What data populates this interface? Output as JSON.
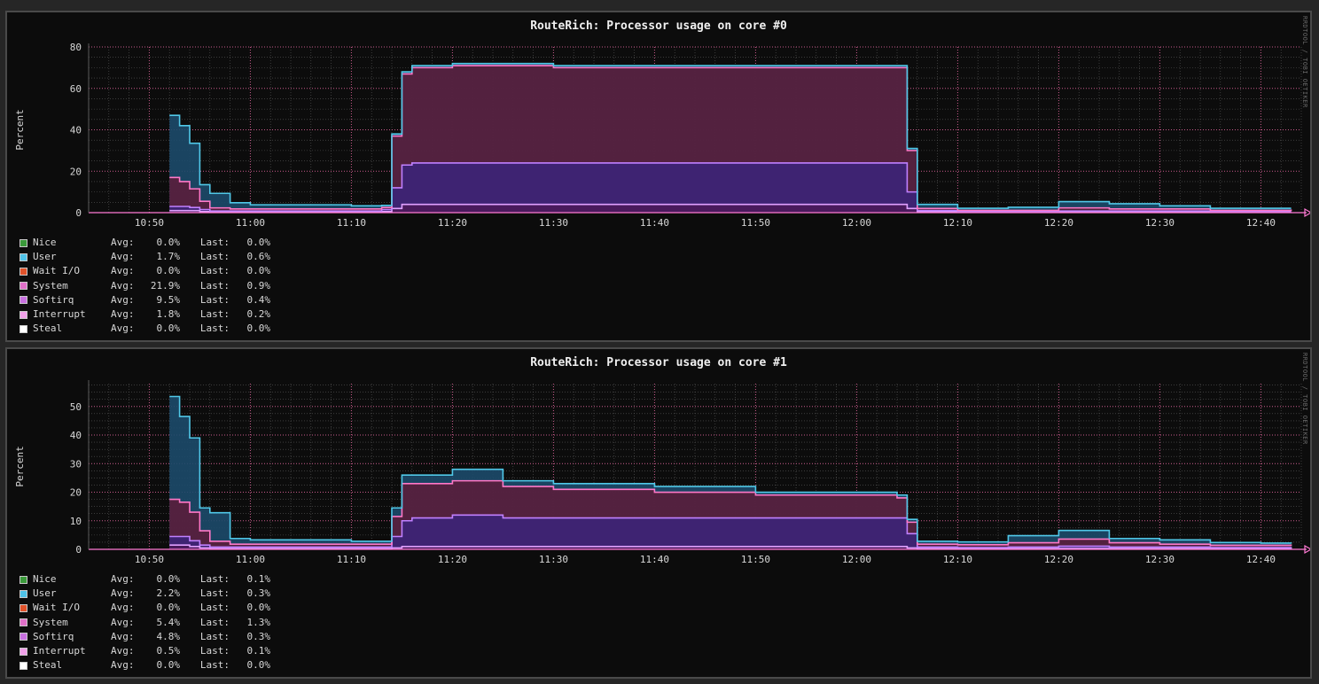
{
  "chart_data": [
    {
      "type": "area",
      "title": "RouteRich: Processor usage on core #0",
      "ylabel": "Percent",
      "xlabel": "",
      "watermark": "RRDTOOL / TOBI OETIKER",
      "ylim": [
        0,
        80
      ],
      "yticks": [
        0,
        20,
        40,
        60,
        80
      ],
      "xlim": [
        "10:44",
        "12:44"
      ],
      "xticks": [
        "10:50",
        "11:00",
        "11:10",
        "11:20",
        "11:30",
        "11:40",
        "11:50",
        "12:00",
        "12:10",
        "12:20",
        "12:30",
        "12:40"
      ],
      "grid": true,
      "stacked": true,
      "legend_position": "bottom-left",
      "x": [
        "10:52",
        "10:53",
        "10:54",
        "10:55",
        "10:56",
        "10:58",
        "11:00",
        "11:05",
        "11:10",
        "11:13",
        "11:14",
        "11:15",
        "11:16",
        "11:20",
        "11:30",
        "11:40",
        "11:50",
        "12:00",
        "12:04",
        "12:05",
        "12:06",
        "12:10",
        "12:15",
        "12:20",
        "12:25",
        "12:30",
        "12:35",
        "12:40",
        "12:43"
      ],
      "series": [
        {
          "name": "Interrupt",
          "values": [
            1,
            1,
            1,
            0.5,
            0.3,
            0.3,
            0.3,
            0.3,
            0.3,
            0.5,
            2,
            4,
            4,
            4,
            4,
            4,
            4,
            4,
            4,
            2,
            0.5,
            0.3,
            0.3,
            0.3,
            0.3,
            0.3,
            0.3,
            0.3,
            0.3
          ]
        },
        {
          "name": "Softirq",
          "values": [
            2,
            2,
            1.5,
            1,
            0.5,
            0.5,
            0.5,
            0.5,
            0.5,
            1,
            10,
            19,
            20,
            20,
            20,
            20,
            20,
            20,
            20,
            8,
            0.5,
            0.3,
            0.3,
            0.5,
            0.5,
            0.5,
            0.3,
            0.3,
            0.3
          ]
        },
        {
          "name": "System",
          "values": [
            14,
            12,
            9,
            4,
            1.5,
            1,
            1,
            1,
            1,
            1,
            25,
            44,
            46,
            47,
            46,
            46,
            46,
            46,
            46,
            20,
            1,
            0.5,
            0.5,
            1.5,
            1,
            1,
            0.5,
            0.5,
            0.9
          ]
        },
        {
          "name": "Wait I/O",
          "values": [
            0,
            0,
            0,
            0,
            0,
            0,
            0,
            0,
            0,
            0,
            0,
            0,
            0,
            0,
            0,
            0,
            0,
            0,
            0,
            0,
            0,
            0,
            0,
            0,
            0,
            0,
            0,
            0,
            0
          ]
        },
        {
          "name": "User",
          "values": [
            30,
            27,
            22,
            8,
            7,
            3,
            2,
            2,
            1.5,
            1,
            1,
            1,
            1,
            1,
            1,
            1,
            1,
            1,
            1,
            1,
            2,
            1,
            1.5,
            3,
            2.5,
            1.5,
            1,
            1,
            0.6
          ]
        },
        {
          "name": "Nice",
          "values": [
            0,
            0,
            0,
            0,
            0,
            0,
            0,
            0,
            0,
            0,
            0,
            0,
            0,
            0,
            0,
            0,
            0,
            0,
            0,
            0,
            0,
            0,
            0,
            0,
            0,
            0,
            0,
            0,
            0
          ]
        },
        {
          "name": "Steal",
          "values": [
            0,
            0,
            0,
            0,
            0,
            0,
            0,
            0,
            0,
            0,
            0,
            0,
            0,
            0,
            0,
            0,
            0,
            0,
            0,
            0,
            0,
            0,
            0,
            0,
            0,
            0,
            0,
            0,
            0
          ]
        }
      ],
      "legend": [
        {
          "name": "Nice",
          "avg": "0.0%",
          "last": "0.0%",
          "color": "#3a9a3a"
        },
        {
          "name": "User",
          "avg": "1.7%",
          "last": "0.6%",
          "color": "#4fc3e8"
        },
        {
          "name": "Wait I/O",
          "avg": "0.0%",
          "last": "0.0%",
          "color": "#e0522a"
        },
        {
          "name": "System",
          "avg": "21.9%",
          "last": "0.9%",
          "color": "#e070c8"
        },
        {
          "name": "Softirq",
          "avg": "9.5%",
          "last": "0.4%",
          "color": "#c870e0"
        },
        {
          "name": "Interrupt",
          "avg": "1.8%",
          "last": "0.2%",
          "color": "#f0a0e8"
        },
        {
          "name": "Steal",
          "avg": "0.0%",
          "last": "0.0%",
          "color": "#ffffff"
        }
      ]
    },
    {
      "type": "area",
      "title": "RouteRich: Processor usage on core #1",
      "ylabel": "Percent",
      "xlabel": "",
      "watermark": "RRDTOOL / TOBI OETIKER",
      "ylim": [
        0,
        58
      ],
      "yticks": [
        0,
        10,
        20,
        30,
        40,
        50
      ],
      "xlim": [
        "10:44",
        "12:44"
      ],
      "xticks": [
        "10:50",
        "11:00",
        "11:10",
        "11:20",
        "11:30",
        "11:40",
        "11:50",
        "12:00",
        "12:10",
        "12:20",
        "12:30",
        "12:40"
      ],
      "grid": true,
      "stacked": true,
      "legend_position": "bottom-left",
      "x": [
        "10:52",
        "10:53",
        "10:54",
        "10:55",
        "10:56",
        "10:58",
        "11:00",
        "11:05",
        "11:10",
        "11:13",
        "11:14",
        "11:15",
        "11:16",
        "11:20",
        "11:25",
        "11:30",
        "11:40",
        "11:50",
        "12:00",
        "12:04",
        "12:05",
        "12:06",
        "12:10",
        "12:15",
        "12:20",
        "12:25",
        "12:30",
        "12:35",
        "12:40",
        "12:43"
      ],
      "series": [
        {
          "name": "Interrupt",
          "values": [
            1.5,
            1.5,
            1,
            0.5,
            0.3,
            0.3,
            0.3,
            0.3,
            0.3,
            0.3,
            0.5,
            1,
            1,
            1,
            1,
            1,
            1,
            1,
            1,
            1,
            0.5,
            0.3,
            0.3,
            0.3,
            0.3,
            0.3,
            0.3,
            0.3,
            0.3,
            0.1
          ]
        },
        {
          "name": "Softirq",
          "values": [
            3,
            3,
            2,
            1,
            0.5,
            0.5,
            0.5,
            0.5,
            0.5,
            0.5,
            4,
            9,
            10,
            11,
            10,
            10,
            10,
            10,
            10,
            10,
            5,
            0.5,
            0.3,
            0.5,
            0.8,
            0.5,
            0.5,
            0.3,
            0.3,
            0.3
          ]
        },
        {
          "name": "System",
          "values": [
            13,
            12,
            10,
            5,
            2,
            1,
            1,
            1,
            1,
            1,
            7,
            13,
            12,
            12,
            11,
            10,
            9,
            8,
            8,
            7,
            4,
            1,
            1,
            1.5,
            2.5,
            1.5,
            1,
            0.8,
            0.8,
            1.3
          ]
        },
        {
          "name": "Wait I/O",
          "values": [
            0,
            0,
            0,
            0,
            0,
            0,
            0,
            0,
            0,
            0,
            0,
            0,
            0,
            0,
            0,
            0,
            0,
            0,
            0,
            0,
            0,
            0,
            0,
            0,
            0,
            0,
            0,
            0,
            0,
            0
          ]
        },
        {
          "name": "User",
          "values": [
            36,
            30,
            26,
            8,
            10,
            2,
            1.5,
            1.5,
            1,
            1,
            3,
            3,
            3,
            4,
            2,
            2,
            2,
            1,
            1,
            1,
            1,
            1,
            1,
            2.5,
            3,
            1.5,
            1.5,
            1,
            0.8,
            0.3
          ]
        },
        {
          "name": "Nice",
          "values": [
            0,
            0,
            0,
            0,
            0,
            0,
            0,
            0,
            0,
            0,
            0,
            0,
            0,
            0,
            0,
            0,
            0,
            0,
            0,
            0,
            0,
            0,
            0,
            0,
            0,
            0,
            0,
            0,
            0,
            0.1
          ]
        },
        {
          "name": "Steal",
          "values": [
            0,
            0,
            0,
            0,
            0,
            0,
            0,
            0,
            0,
            0,
            0,
            0,
            0,
            0,
            0,
            0,
            0,
            0,
            0,
            0,
            0,
            0,
            0,
            0,
            0,
            0,
            0,
            0,
            0,
            0
          ]
        }
      ],
      "legend": [
        {
          "name": "Nice",
          "avg": "0.0%",
          "last": "0.1%",
          "color": "#3a9a3a"
        },
        {
          "name": "User",
          "avg": "2.2%",
          "last": "0.3%",
          "color": "#4fc3e8"
        },
        {
          "name": "Wait I/O",
          "avg": "0.0%",
          "last": "0.0%",
          "color": "#e0522a"
        },
        {
          "name": "System",
          "avg": "5.4%",
          "last": "1.3%",
          "color": "#e070c8"
        },
        {
          "name": "Softirq",
          "avg": "4.8%",
          "last": "0.3%",
          "color": "#c870e0"
        },
        {
          "name": "Interrupt",
          "avg": "0.5%",
          "last": "0.1%",
          "color": "#f0a0e8"
        },
        {
          "name": "Steal",
          "avg": "0.0%",
          "last": "0.0%",
          "color": "#ffffff"
        }
      ]
    }
  ],
  "labels": {
    "avg": "Avg:",
    "last": "Last:"
  },
  "colors": {
    "background": "#0c0c0c",
    "grid_major": "#c85a8c",
    "grid_minor": "#5a5a5a",
    "axis": "#ff7ad4",
    "fill_system": "#5a1e3c",
    "fill_softirq": "#3c2478",
    "fill_interrupt": "#4a1a5a",
    "fill_user": "#1c4a6a",
    "line_system": "#ff78c8",
    "line_softirq": "#c080ff",
    "line_interrupt": "#e0a0ff",
    "line_user": "#50c8e8"
  }
}
